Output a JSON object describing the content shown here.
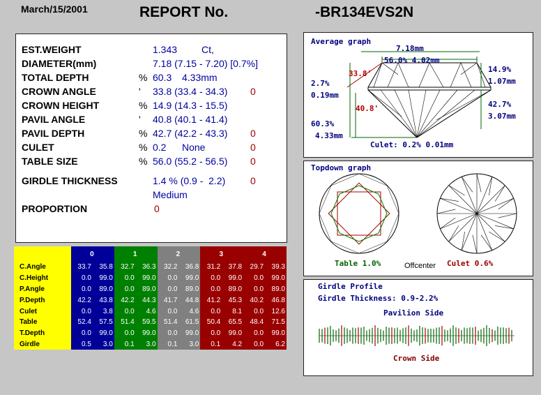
{
  "header": {
    "date": "March/15/2001",
    "title": "REPORT No.",
    "report_number": "-BR134EVS2N"
  },
  "properties": [
    {
      "label": "EST.WEIGHT",
      "unit": "",
      "value": "1.343",
      "value2": "Ct,",
      "flag": ""
    },
    {
      "label": "DIAMETER(mm)",
      "unit": "",
      "value": "7.18 (7.15 - 7.20) [0.7%]",
      "value2": "",
      "flag": ""
    },
    {
      "label": "TOTAL DEPTH",
      "unit": "%",
      "value": "60.3",
      "value2": "4.33mm",
      "flag": ""
    },
    {
      "label": "CROWN ANGLE",
      "unit": "'",
      "value": "33.8 (33.4 - 34.3)",
      "value2": "",
      "flag": "0"
    },
    {
      "label": "CROWN HEIGHT",
      "unit": "%",
      "value": "14.9 (14.3 - 15.5)",
      "value2": "",
      "flag": ""
    },
    {
      "label": "PAVIL ANGLE",
      "unit": "'",
      "value": "40.8 (40.1 - 41.4)",
      "value2": "",
      "flag": ""
    },
    {
      "label": "PAVIL DEPTH",
      "unit": "%",
      "value": "42.7 (42.2 - 43.3)",
      "value2": "",
      "flag": "0"
    },
    {
      "label": "CULET",
      "unit": "%",
      "value": "0.2",
      "value2": "None",
      "flag": "0"
    },
    {
      "label": "TABLE SIZE",
      "unit": "%",
      "value": "56.0 (55.2 - 56.5)",
      "value2": "",
      "flag": "0"
    }
  ],
  "girdle": {
    "label": "GIRDLE THICKNESS",
    "value": "1.4 % (0.9 -  2.2)",
    "flag": "0",
    "grade": "Medium"
  },
  "proportion": {
    "label": "PROPORTION",
    "value": "0"
  },
  "stats_table": {
    "groups": [
      "0",
      "1",
      "2",
      "3",
      "4"
    ],
    "rows": [
      {
        "label": "C.Angle",
        "cells": [
          "33.7",
          "35.8",
          "32.7",
          "36.3",
          "32.2",
          "36.8",
          "31.2",
          "37.8",
          "29.7",
          "39.3"
        ]
      },
      {
        "label": "C.Height",
        "cells": [
          "0.0",
          "99.0",
          "0.0",
          "99.0",
          "0.0",
          "99.0",
          "0.0",
          "99.0",
          "0.0",
          "99.0"
        ]
      },
      {
        "label": "P.Angle",
        "cells": [
          "0.0",
          "89.0",
          "0.0",
          "89.0",
          "0.0",
          "89.0",
          "0.0",
          "89.0",
          "0.0",
          "89.0"
        ]
      },
      {
        "label": "P.Depth",
        "cells": [
          "42.2",
          "43.8",
          "42.2",
          "44.3",
          "41.7",
          "44.8",
          "41.2",
          "45.3",
          "40.2",
          "46.8"
        ]
      },
      {
        "label": "Culet",
        "cells": [
          "0.0",
          "3.8",
          "0.0",
          "4.6",
          "0.0",
          "4.6",
          "0.0",
          "8.1",
          "0.0",
          "12.6"
        ]
      },
      {
        "label": "Table",
        "cells": [
          "52.4",
          "57.5",
          "51.4",
          "59.5",
          "51.4",
          "61.5",
          "50.4",
          "65.5",
          "48.4",
          "71.5"
        ]
      },
      {
        "label": "T.Depth",
        "cells": [
          "0.0",
          "99.0",
          "0.0",
          "99.0",
          "0.0",
          "99.0",
          "0.0",
          "99.0",
          "0.0",
          "99.0"
        ]
      },
      {
        "label": "Girdle",
        "cells": [
          "0.5",
          "3.0",
          "0.1",
          "3.0",
          "0.1",
          "3.0",
          "0.1",
          "4.2",
          "0.0",
          "6.2"
        ]
      }
    ]
  },
  "average_graph": {
    "title": "Average graph",
    "diameter": "7.18mm",
    "table": "56.0% 4.02mm",
    "crown_angle": "33.8'",
    "pavilion_angle": "40.8'",
    "left_top_pct": "2.7%",
    "left_top_mm": "0.19mm",
    "left_bottom_pct": "60.3%",
    "left_bottom_mm": "4.33mm",
    "right_top_pct": "14.9%",
    "right_top_mm": "1.07mm",
    "right_bottom_pct": "42.7%",
    "right_bottom_mm": "3.07mm",
    "culet": "Culet: 0.2% 0.01mm"
  },
  "topdown_graph": {
    "title": "Topdown graph",
    "table_label": "Table 1.0%",
    "offcenter_label": "Offcenter",
    "culet_label": "Culet 0.6%"
  },
  "girdle_profile": {
    "title": "Girdle Profile",
    "thickness": "Girdle Thickness: 0.9-2.2%",
    "pavilion_side": "Pavilion Side",
    "crown_side": "Crown Side"
  },
  "colors": {
    "background": "#c6c6c6",
    "value_blue": "#0000a0",
    "flag_red": "#a00000",
    "group0": "#000099",
    "group1": "#008000",
    "group2": "#808080",
    "group3": "#990000",
    "label_yellow": "#ffff00"
  }
}
